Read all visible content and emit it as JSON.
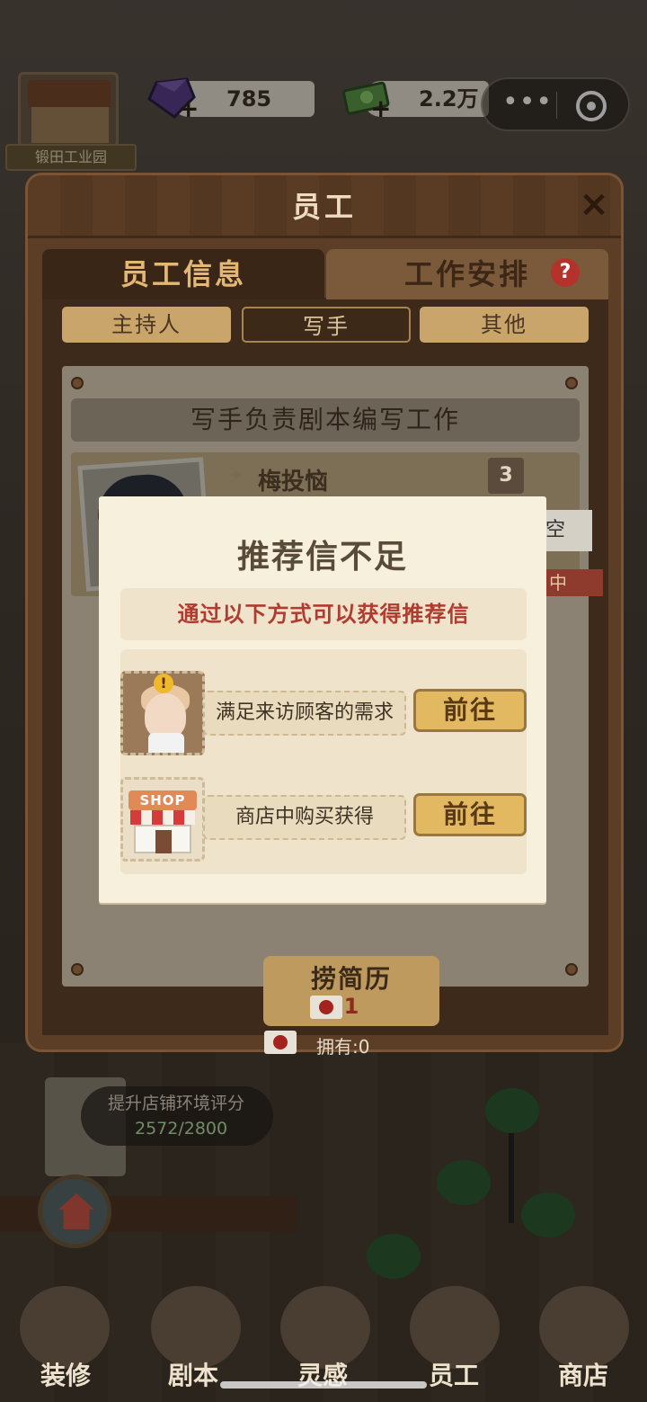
{
  "hud": {
    "location": "锻田工业园",
    "gems": "785",
    "money": "2.2万",
    "gem_plus": "+",
    "money_plus": "+",
    "menu_dots": "•••"
  },
  "panel": {
    "title": "员工",
    "close": "×",
    "tab_info": "员工信息",
    "tab_work": "工作安排",
    "help": "?",
    "sub_tabs": [
      "主持人",
      "写手",
      "其他"
    ],
    "description": "写手负责剧本编写工作",
    "candidate": {
      "name": "梅投恼",
      "level": "3",
      "tag_a": "空",
      "tag_b": "中"
    },
    "hire_label": "捞简历",
    "hire_cost": "1",
    "own": "拥有:0"
  },
  "scene": {
    "env_title": "提升店铺环境评分",
    "env_value": "2572/2800"
  },
  "nav": {
    "items": [
      "装修",
      "剧本",
      "灵感",
      "员工",
      "商店"
    ]
  },
  "modal": {
    "title": "推荐信不足",
    "subtitle": "通过以下方式可以获得推荐信",
    "options": [
      {
        "label": "满足来访顾客的需求",
        "button": "前往"
      },
      {
        "label": "商店中购买获得",
        "button": "前往"
      }
    ],
    "alert_mark": "!",
    "shop_sign": "SHOP"
  }
}
